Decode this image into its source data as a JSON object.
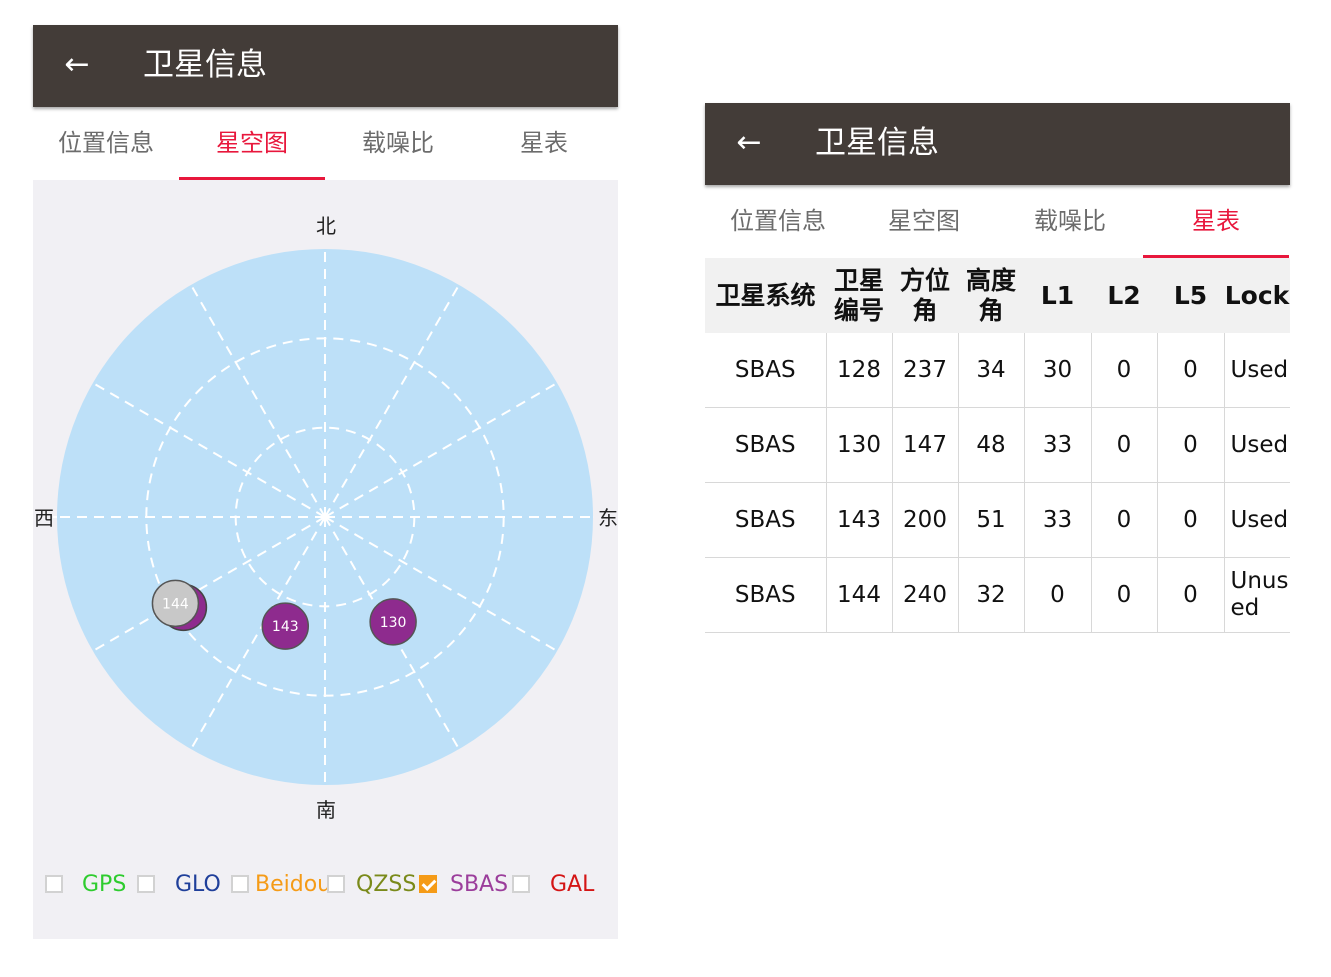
{
  "left_screen": {
    "title": "卫星信息",
    "back_icon": "arrow-left-icon",
    "tabs": [
      {
        "label": "位置信息",
        "active": false
      },
      {
        "label": "星空图",
        "active": true
      },
      {
        "label": "载噪比",
        "active": false
      },
      {
        "label": "星表",
        "active": false
      }
    ],
    "skyplot": {
      "north": "北",
      "south": "南",
      "east": "东",
      "west": "西",
      "satellites": [
        {
          "id": "144",
          "color": "#c8c8c8",
          "azimuth": 240,
          "elevation": 32,
          "shadow_color": "#8e2b8e"
        },
        {
          "id": "143",
          "color": "#8e2b8e",
          "azimuth": 200,
          "elevation": 51
        },
        {
          "id": "130",
          "color": "#8e2b8e",
          "azimuth": 147,
          "elevation": 48
        }
      ],
      "colors": {
        "sky": "#bde0f8",
        "grid": "#ffffff",
        "background": "#f1f0f4"
      }
    },
    "legend": [
      {
        "label": "GPS",
        "checked": false,
        "color": "#2ecc2e"
      },
      {
        "label": "GLO",
        "checked": false,
        "color": "#1f3f9a"
      },
      {
        "label": "Beidou",
        "checked": false,
        "color": "#f59b17"
      },
      {
        "label": "QZSS",
        "checked": false,
        "color": "#7a8a1a"
      },
      {
        "label": "SBAS",
        "checked": true,
        "color": "#9b3d9b"
      },
      {
        "label": "GAL",
        "checked": false,
        "color": "#d41515"
      }
    ]
  },
  "right_screen": {
    "title": "卫星信息",
    "back_icon": "arrow-left-icon",
    "tabs": [
      {
        "label": "位置信息",
        "active": false
      },
      {
        "label": "星空图",
        "active": false
      },
      {
        "label": "载噪比",
        "active": false
      },
      {
        "label": "星表",
        "active": true
      }
    ],
    "table": {
      "headers": [
        [
          "卫星系统"
        ],
        [
          "卫星",
          "编号"
        ],
        [
          "方位",
          "角"
        ],
        [
          "高度",
          "角"
        ],
        [
          "L1"
        ],
        [
          "L2"
        ],
        [
          "L5"
        ],
        [
          "Lock"
        ]
      ],
      "rows": [
        [
          "SBAS",
          "128",
          "237",
          "34",
          "30",
          "0",
          "0",
          "Used"
        ],
        [
          "SBAS",
          "130",
          "147",
          "48",
          "33",
          "0",
          "0",
          "Used"
        ],
        [
          "SBAS",
          "143",
          "200",
          "51",
          "33",
          "0",
          "0",
          "Used"
        ],
        [
          "SBAS",
          "144",
          "240",
          "32",
          "0",
          "0",
          "0",
          "Unused"
        ]
      ]
    }
  },
  "colors": {
    "appbar": "#433c38",
    "accent": "#e8173c",
    "tab_text": "#6c6c6c"
  }
}
